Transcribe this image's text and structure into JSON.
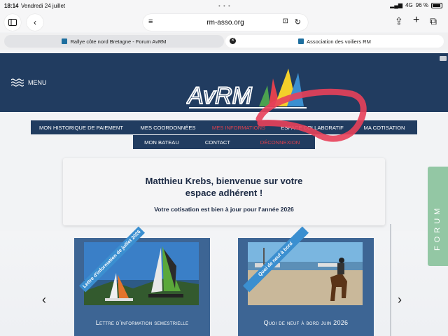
{
  "status_bar": {
    "time": "18:14",
    "date": "Vendredi 24 juillet",
    "network": "4G",
    "battery": "96 %"
  },
  "browser": {
    "url": "rm-asso.org"
  },
  "tabs": [
    {
      "title": "Rallye côte nord Bretagne - Forum AvRM",
      "active": false
    },
    {
      "title": "Association des voiliers RM",
      "active": true
    }
  ],
  "header": {
    "menu_label": "MENU",
    "logo_text": "AvRM",
    "brand_color": "#213c60"
  },
  "nav": {
    "row1": [
      {
        "label": "MON HISTORIQUE DE PAIEMENT"
      },
      {
        "label": "MES COORDONNÉES"
      },
      {
        "label": "MES INFORMATIONS",
        "active": true
      },
      {
        "label": "ESPACE COLLABORATIF"
      },
      {
        "label": "MA COTISATION"
      }
    ],
    "row2": [
      {
        "label": "MON BATEAU"
      },
      {
        "label": "CONTACT"
      },
      {
        "label": "DÉCONNEXION",
        "active": true
      }
    ],
    "active_color": "#e0414e"
  },
  "welcome": {
    "title": "Matthieu Krebs, bienvenue sur votre espace adhérent !",
    "status": "Votre cotisation est bien à jour pour l'année 2026"
  },
  "slides": [
    {
      "ribbon": "Lettre d'information de juillet 2026",
      "caption": "Lettre d'information semestrielle"
    },
    {
      "ribbon": "Quoi de neuf à bord",
      "caption": "Quoi de neuf à bord juin 2026"
    }
  ],
  "forum_tab": {
    "label": "FORUM",
    "color": "#93c7a4"
  },
  "annotation": {
    "color": "#e8405a"
  }
}
